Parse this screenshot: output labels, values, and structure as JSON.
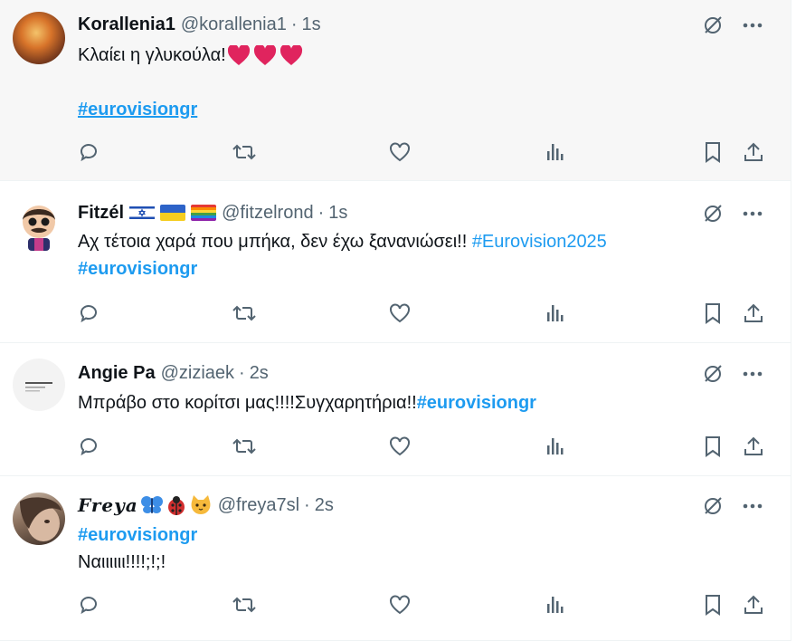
{
  "tweets": [
    {
      "display_name": "Korallenia1",
      "handle": "@korallenia1",
      "separator": "·",
      "time": "1s",
      "text_line1": "Κλαίει η γλυκούλα!",
      "hashtag_line": "#eurovisiongr"
    },
    {
      "display_name": "Fitzél",
      "handle": "@fitzelrond",
      "separator": "·",
      "time": "1s",
      "text_line1": "Αχ τέτοια χαρά που μπήκα, δεν έχω ξανανιώσει!! ",
      "text_hashtag1": "#Eurovision2025",
      "hashtag_line": "#eurovisiongr"
    },
    {
      "display_name": "Angie Pa",
      "handle": "@ziziaek",
      "separator": "·",
      "time": "2s",
      "text_line1": "Μπράβο στο κορίτσι μας!!!!Συγχαρητήρια!!",
      "text_hashtag1": "#eurovisiongr"
    },
    {
      "display_name": "Freya",
      "handle": "@freya7sl",
      "separator": "·",
      "time": "2s",
      "hashtag_line": "#eurovisiongr",
      "text_line2": "Ναιιιιιι!!!!;!;!"
    }
  ],
  "icons": {
    "reply": "reply-icon",
    "retweet": "retweet-icon",
    "like": "like-icon",
    "views": "views-icon",
    "bookmark": "bookmark-icon",
    "share": "share-icon",
    "grok": "grok-icon",
    "more": "more-icon"
  },
  "colors": {
    "link": "#1d9bf0",
    "secondary_text": "#536471",
    "heart": "#e0245e",
    "highlight_bg": "#f7f7f7"
  }
}
